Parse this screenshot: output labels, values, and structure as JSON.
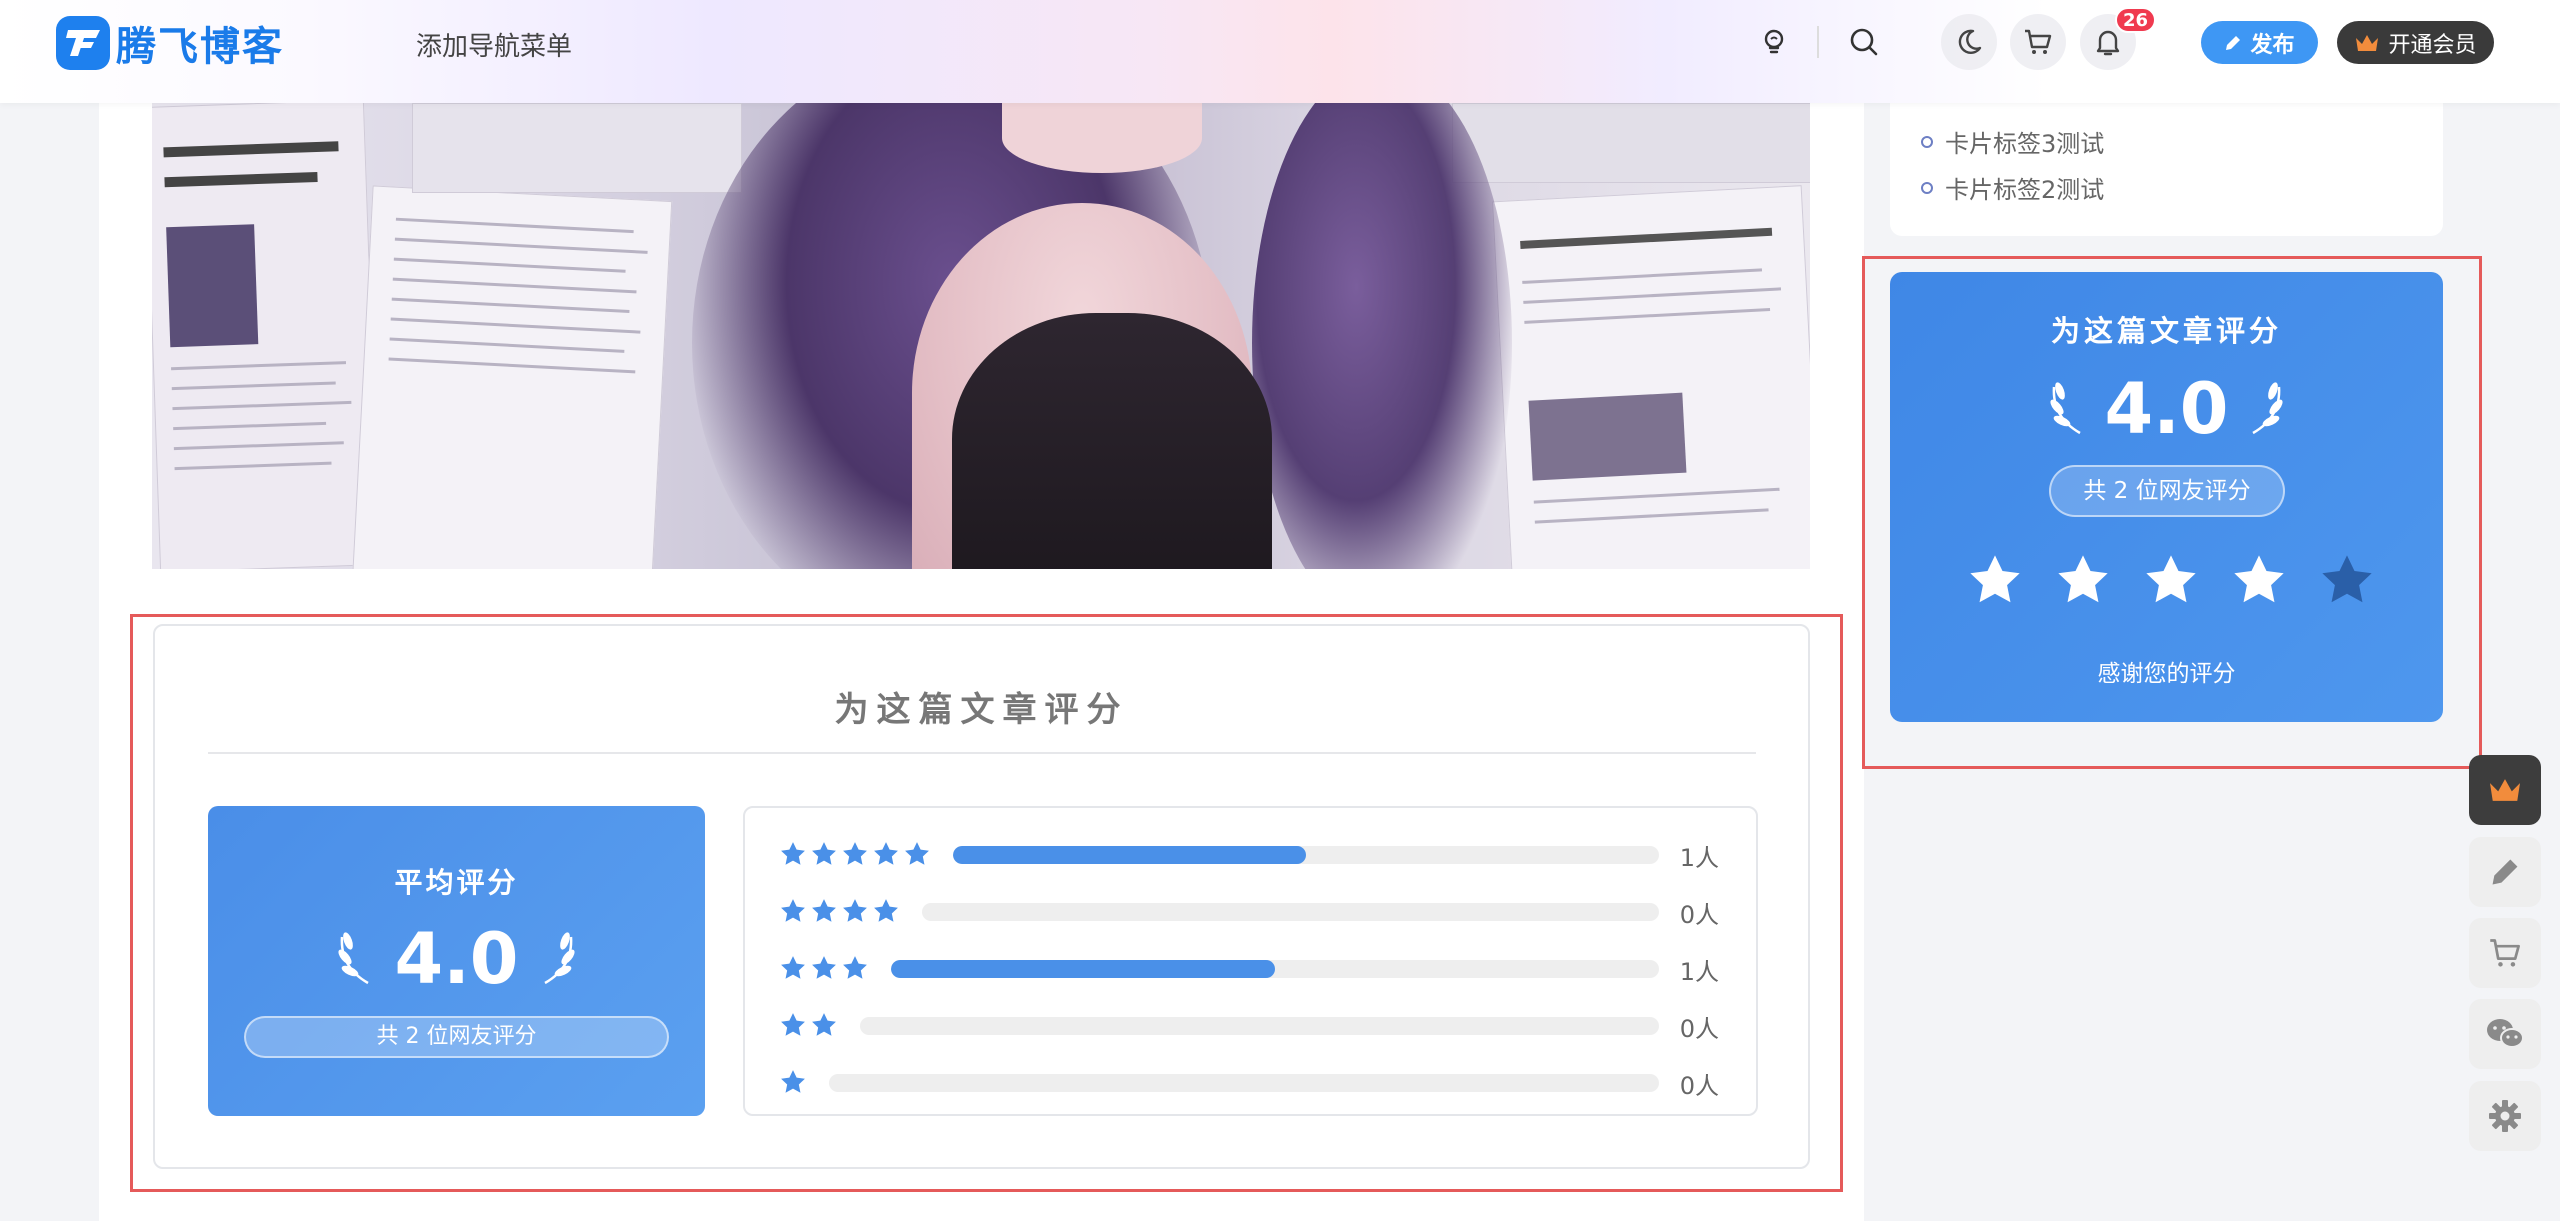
{
  "header": {
    "logo_text": "腾飞博客",
    "nav_add": "添加导航菜单",
    "notification_count": "26",
    "publish_label": "发布",
    "vip_label": "开通会员"
  },
  "sidebar": {
    "tags": [
      {
        "label": "卡片标签3测试"
      },
      {
        "label": "卡片标签2测试"
      }
    ],
    "rating": {
      "title": "为这篇文章评分",
      "score": "4.0",
      "count_label": "共 2 位网友评分",
      "stars_selected": 4,
      "stars_total": 5,
      "thanks": "感谢您的评分"
    }
  },
  "rating_section": {
    "title": "为这篇文章评分",
    "avg_label": "平均评分",
    "avg_score": "4.0",
    "count_label": "共 2 位网友评分",
    "distribution": [
      {
        "stars": 5,
        "count_label": "1人",
        "fraction": 0.5
      },
      {
        "stars": 4,
        "count_label": "0人",
        "fraction": 0
      },
      {
        "stars": 3,
        "count_label": "1人",
        "fraction": 0.5
      },
      {
        "stars": 2,
        "count_label": "0人",
        "fraction": 0
      },
      {
        "stars": 1,
        "count_label": "0人",
        "fraction": 0
      }
    ]
  },
  "colors": {
    "accent": "#4a90e8",
    "highlight_outline": "#e55a5a",
    "badge": "#f03a4f",
    "star_unselected": "#2a5fa8"
  },
  "icons": {
    "header": [
      "light-bulb-icon",
      "search-icon",
      "moon-icon",
      "cart-icon",
      "bell-icon",
      "pencil-icon",
      "crown-icon"
    ],
    "floating": [
      "crown-icon",
      "pencil-icon",
      "cart-icon",
      "wechat-icon",
      "gear-icon"
    ]
  }
}
